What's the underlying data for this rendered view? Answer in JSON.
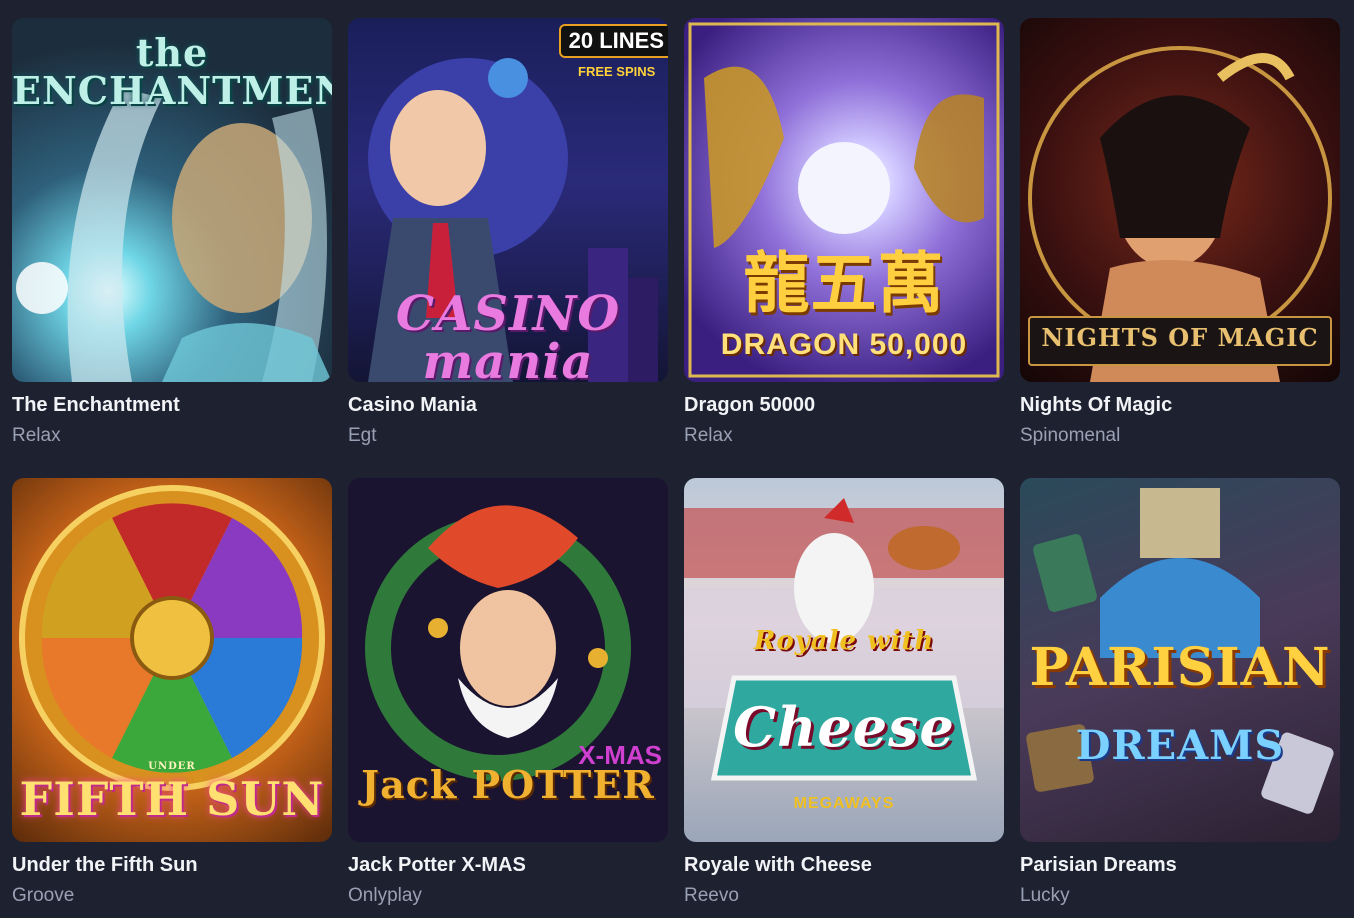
{
  "games": [
    {
      "title": "The Enchantment",
      "provider": "Relax",
      "art_text": "the ENCHANTMENT"
    },
    {
      "title": "Casino Mania",
      "provider": "Egt",
      "art_text": "CASINO mania",
      "badge_lines": "20 LINES",
      "badge_spins": "FREE SPINS"
    },
    {
      "title": "Dragon 50000",
      "provider": "Relax",
      "art_text": "龍五萬",
      "art_subtext": "DRAGON 50,000"
    },
    {
      "title": "Nights Of Magic",
      "provider": "Spinomenal",
      "art_text": "NIGHTS OF MAGIC"
    },
    {
      "title": "Under the Fifth Sun",
      "provider": "Groove",
      "art_text": "FIFTH SUN",
      "art_subtext": "UNDER"
    },
    {
      "title": "Jack Potter X-MAS",
      "provider": "Onlyplay",
      "art_text": "Jack POTTER",
      "art_subtext": "X-MAS"
    },
    {
      "title": "Royale with Cheese",
      "provider": "Reevo",
      "art_text": "Cheese",
      "art_subtext": "Royale with",
      "art_badge": "MEGAWAYS"
    },
    {
      "title": "Parisian Dreams",
      "provider": "Lucky",
      "art_text": "PARISIAN",
      "art_subtext": "DREAMS"
    }
  ],
  "colors": {
    "background": "#1e2230",
    "title": "#f2f3f7",
    "provider": "#9aa0b3"
  }
}
